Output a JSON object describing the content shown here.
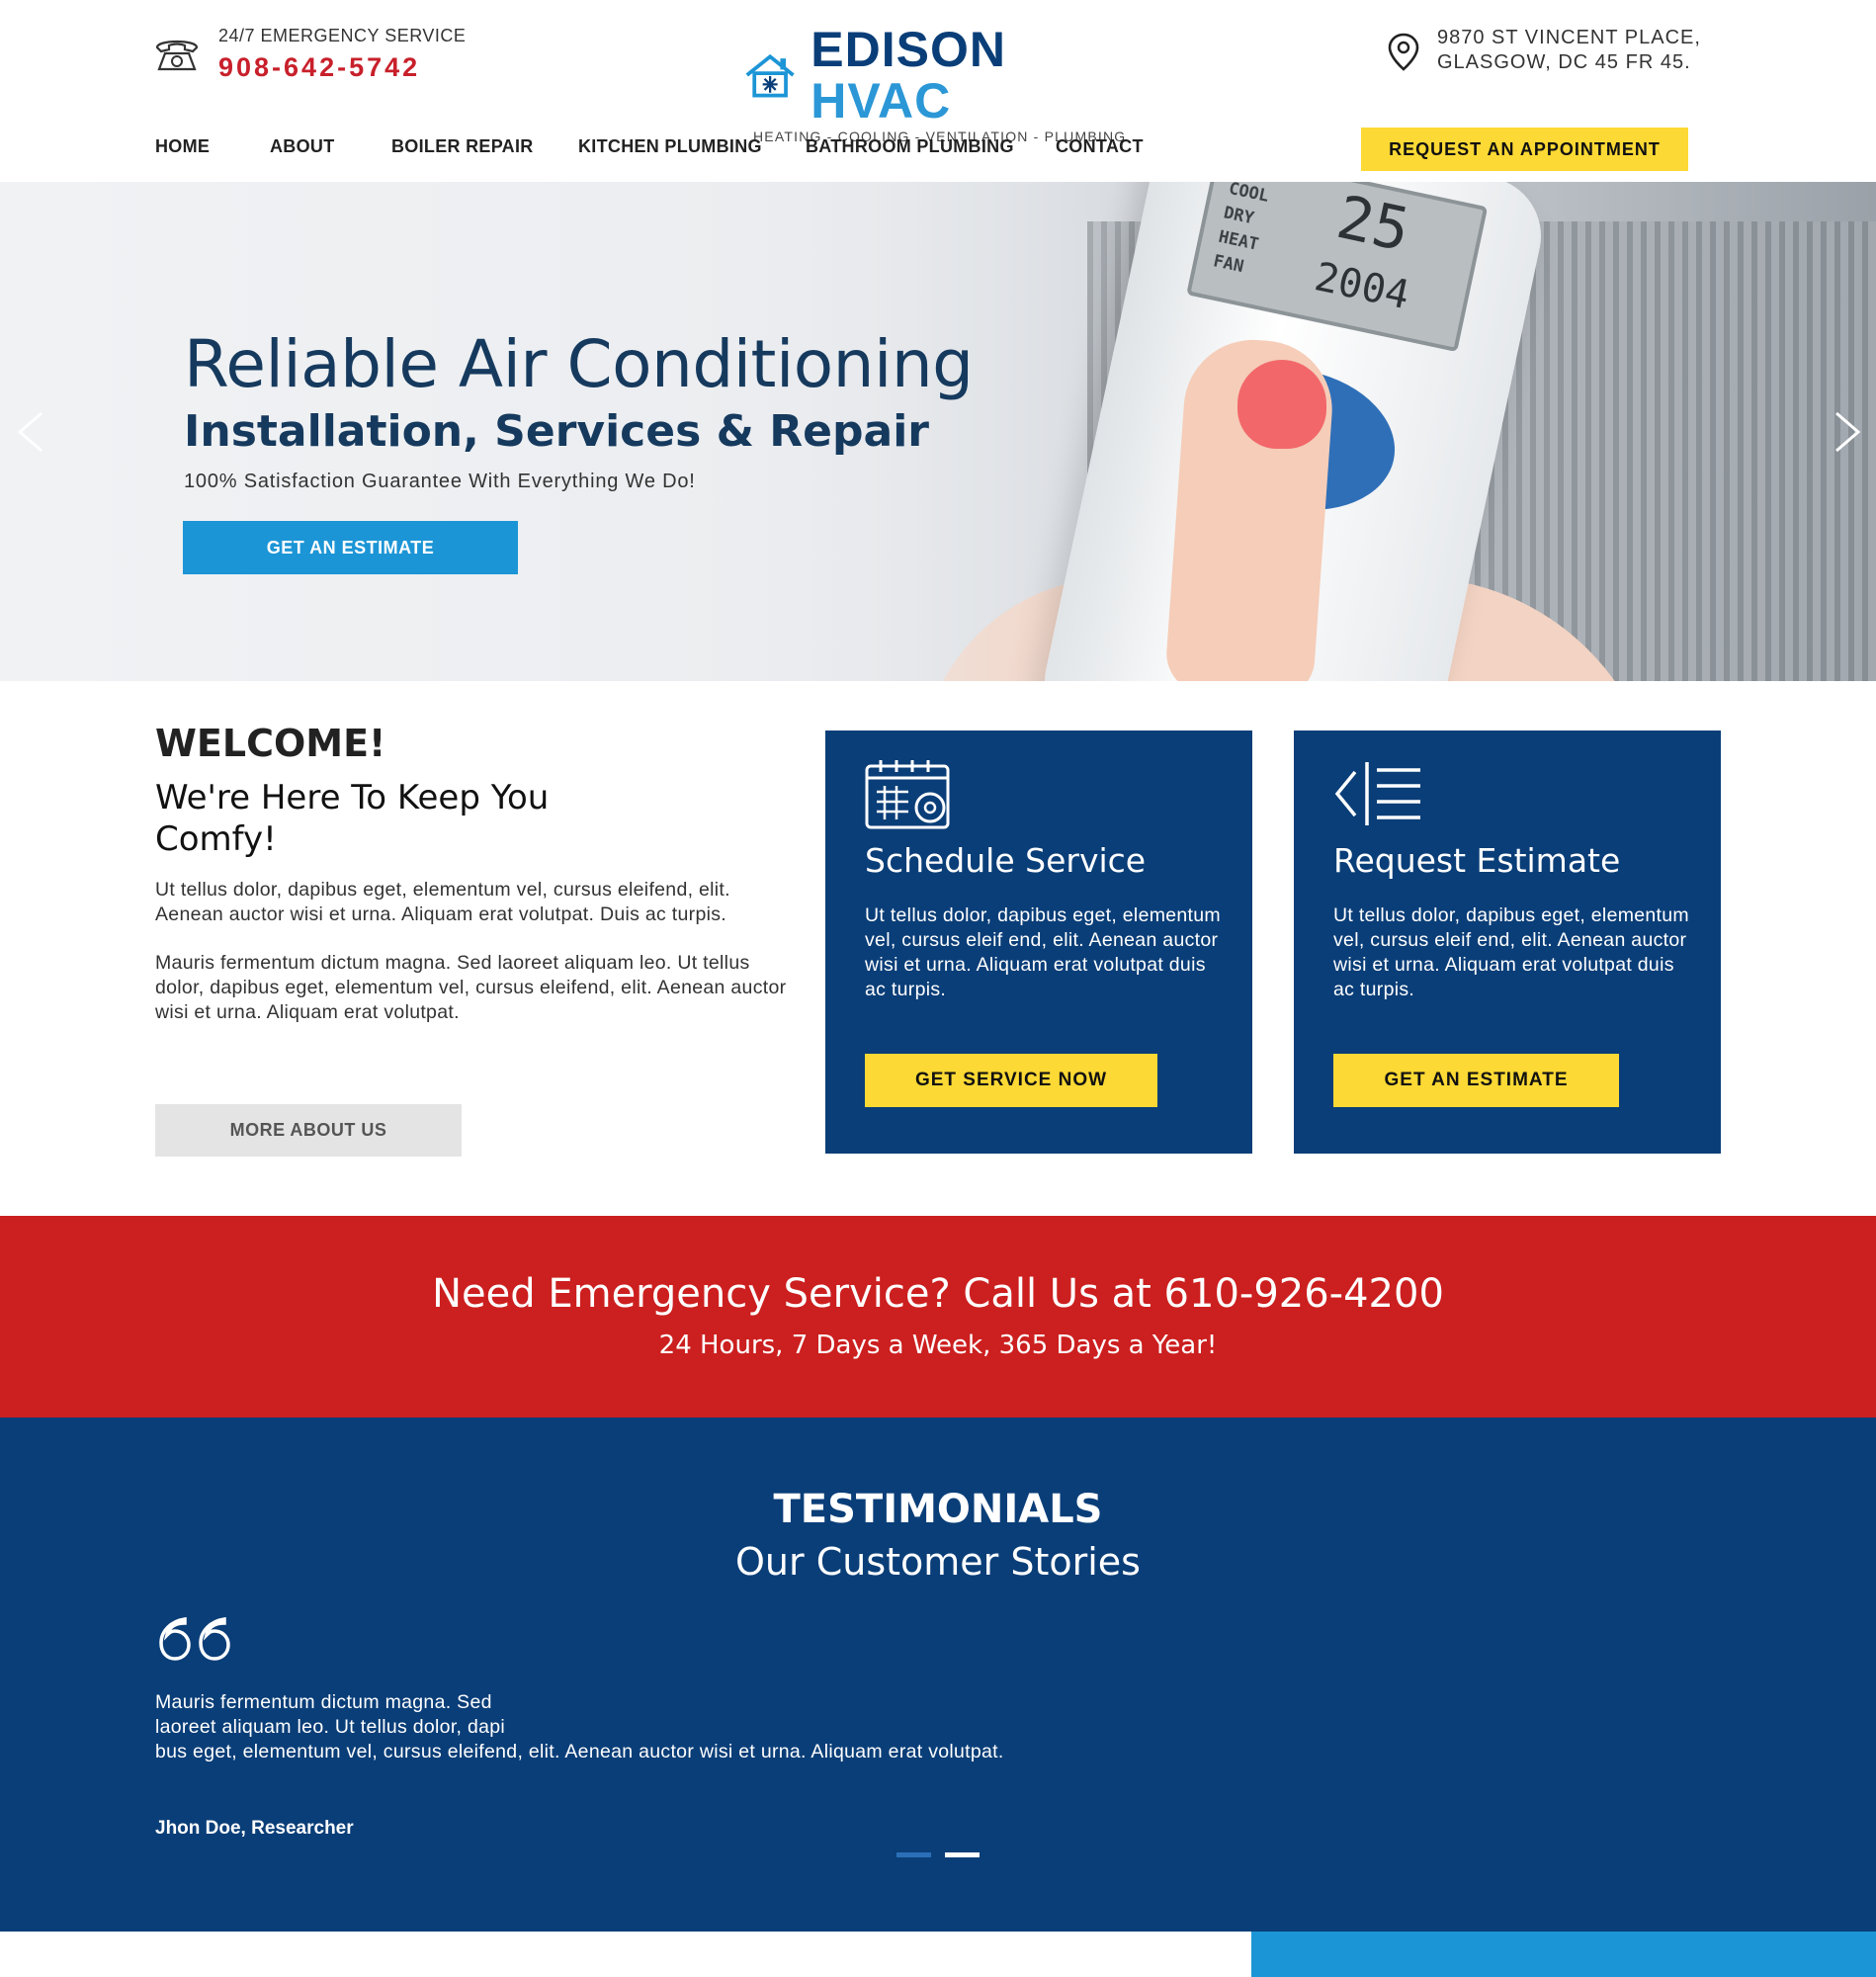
{
  "header": {
    "emergency_label": "24/7 EMERGENCY SERVICE",
    "emergency_phone": "908-642-5742",
    "logo_part1": "EDISON",
    "logo_part2": "HVAC",
    "logo_tagline": "HEATING - COOLING - VENTILATION - PLUMBING",
    "address_line1": "9870 ST VINCENT PLACE,",
    "address_line2": "GLASGOW, DC 45 FR 45."
  },
  "nav": {
    "items": [
      {
        "label": "HOME"
      },
      {
        "label": "ABOUT"
      },
      {
        "label": "BOILER REPAIR"
      },
      {
        "label": "KITCHEN PLUMBING"
      },
      {
        "label": "BATHROOM PLUMBING"
      },
      {
        "label": "CONTACT"
      }
    ],
    "cta_label": "REQUEST AN APPOINTMENT"
  },
  "hero": {
    "title": "Reliable Air Conditioning",
    "subtitle": "Installation, Services & Repair",
    "note": "100% Satisfaction Guarantee With Everything We Do!",
    "button_label": "GET AN ESTIMATE",
    "remote_modes": "COOL\nDRY\nHEAT\nFAN",
    "remote_temp": "25",
    "remote_clock": "2004"
  },
  "welcome": {
    "heading": "WELCOME!",
    "subheading": "We're Here To Keep You Comfy!",
    "paragraph1": "Ut tellus dolor, dapibus eget, elementum vel, cursus eleifend, elit. Aenean auctor wisi et urna. Aliquam erat volutpat. Duis ac turpis.",
    "paragraph2": "Mauris fermentum dictum magna. Sed laoreet aliquam leo. Ut tellus dolor, dapibus eget, elementum vel, cursus eleifend, elit. Aenean auctor wisi et urna. Aliquam erat volutpat.",
    "button_label": "MORE ABOUT US"
  },
  "cards": [
    {
      "title": "Schedule Service",
      "text": "Ut tellus dolor, dapibus eget, elementum vel, cursus eleif end, elit. Aenean auctor wisi et urna. Aliquam erat volutpat duis ac turpis.",
      "button_label": "GET SERVICE NOW",
      "icon": "calendar-gear-icon"
    },
    {
      "title": "Request Estimate",
      "text": "Ut tellus dolor, dapibus eget, elementum vel, cursus eleif end, elit. Aenean auctor wisi et urna. Aliquam erat volutpat duis ac turpis.",
      "button_label": "GET AN ESTIMATE",
      "icon": "list-arrow-icon"
    }
  ],
  "emergency": {
    "title": "Need Emergency Service? Call Us at 610-926-4200",
    "subtitle": "24 Hours, 7 Days a Week, 365 Days a Year!"
  },
  "testimonials": {
    "heading": "TESTIMONIALS",
    "subheading": "Our Customer Stories",
    "quote_line1": "Mauris fermentum dictum magna. Sed",
    "quote_line2": "laoreet aliquam leo. Ut tellus dolor, dapi",
    "quote_line3": "bus eget, elementum vel, cursus eleifend, elit. Aenean auctor wisi et urna. Aliquam erat volutpat.",
    "author": "Jhon Doe, Researcher"
  },
  "colors": {
    "brand_navy": "#0a3e78",
    "brand_blue": "#1c95d6",
    "accent_yellow": "#fcd934",
    "emergency_red": "#cc1f1f",
    "phone_red": "#c8202b"
  }
}
